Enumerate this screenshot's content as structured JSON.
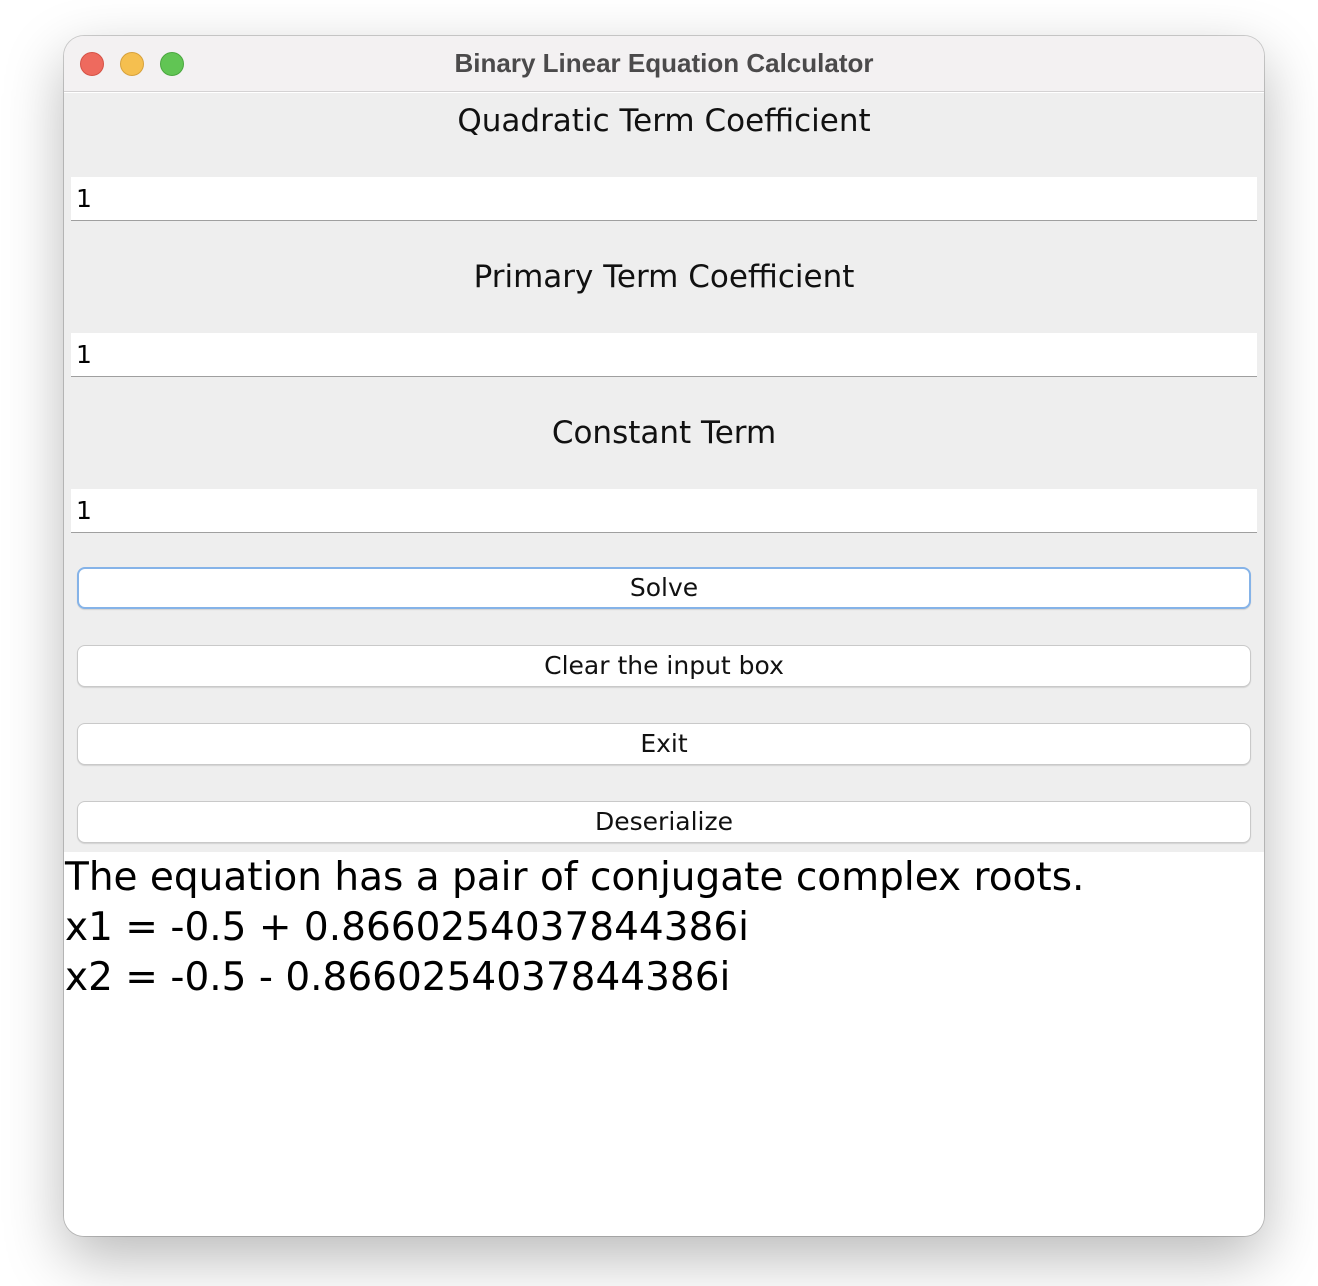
{
  "window": {
    "title": "Binary Linear Equation Calculator",
    "controls": {
      "close": "close-button",
      "minimize": "minimize-button",
      "maximize": "maximize-button"
    }
  },
  "form": {
    "quadratic_label": "Quadratic Term Coefficient",
    "quadratic_value": "1",
    "primary_label": "Primary Term Coefficient",
    "primary_value": "1",
    "constant_label": "Constant Term",
    "constant_value": "1"
  },
  "buttons": {
    "solve": "Solve",
    "clear": "Clear the input box",
    "exit": "Exit",
    "deserialize": "Deserialize"
  },
  "output": {
    "line1": "The equation has a pair of conjugate complex roots.",
    "line2": "x1 = -0.5 + 0.8660254037844386i",
    "line3": "x2 = -0.5 - 0.8660254037844386i"
  },
  "colors": {
    "close": "#ee6a5e",
    "minimize": "#f5bf4f",
    "maximize": "#61c554",
    "focus_ring": "#85b3e8",
    "panel_background": "#eeeeee"
  }
}
